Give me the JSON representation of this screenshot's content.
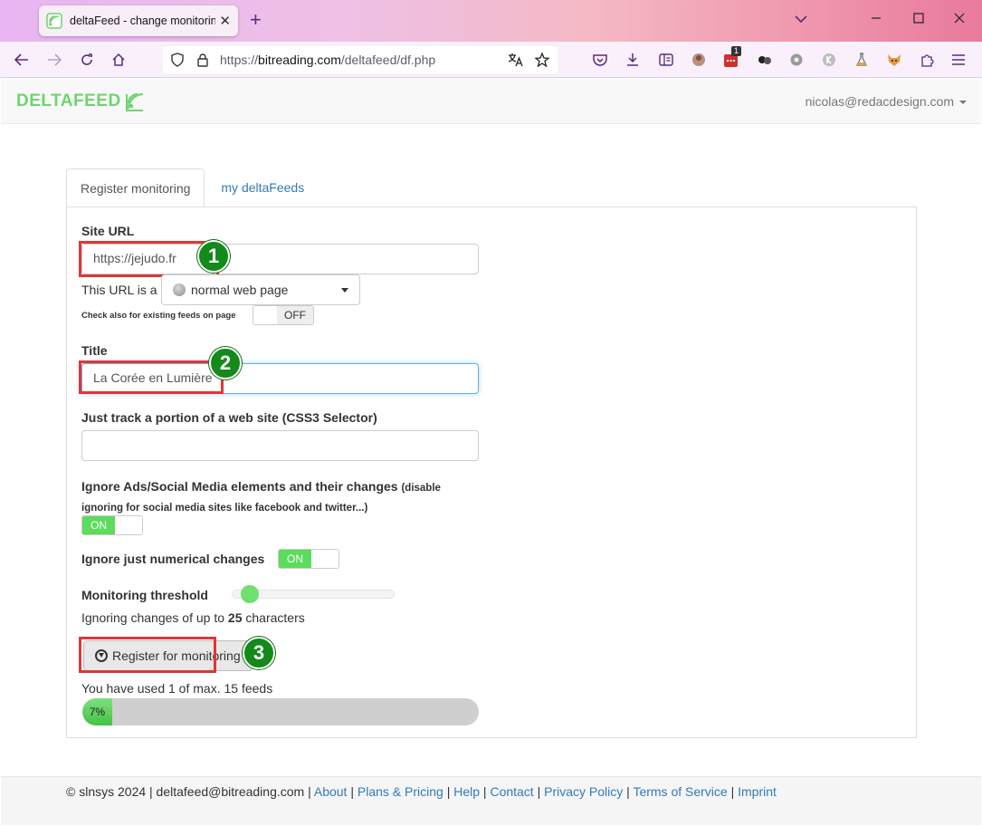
{
  "browser": {
    "tab_title": "deltaFeed - change monitoring",
    "url_prefix": "https://",
    "url_domain": "bitreading.com",
    "url_path": "/deltafeed/df.php",
    "ext_badge_count": "1"
  },
  "app": {
    "logo_text_1": "DELTA",
    "logo_text_2": "FEED",
    "user_email": "nicolas@redacdesign.com"
  },
  "tabs": [
    {
      "label": "Register monitoring"
    },
    {
      "label": "my deltaFeeds"
    }
  ],
  "form": {
    "site_url_label": "Site URL",
    "site_url_value": "https://jejudo.fr",
    "url_type_prefix": "This URL is a",
    "url_type_value": "normal web page",
    "check_feeds_label": "Check also for existing feeds on page",
    "check_feeds_toggle": "OFF",
    "title_label": "Title",
    "title_value": "La Corée en Lumière",
    "selector_label": "Just track a portion of a web site (CSS3 Selector)",
    "selector_value": "",
    "ignore_ads_label": "Ignore Ads/Social Media elements and their changes",
    "ignore_ads_note": "(disable ignoring for social media sites like facebook and twitter...)",
    "ignore_ads_toggle": "ON",
    "ignore_numeric_label": "Ignore just numerical changes",
    "ignore_numeric_toggle": "ON",
    "threshold_label": "Monitoring threshold",
    "threshold_text_pre": "Ignoring changes of up to",
    "threshold_value": "25",
    "threshold_text_post": "characters",
    "threshold_fraction": 0.05,
    "register_button": "Register for monitoring",
    "usage_text": "You have used 1 of max. 15 feeds",
    "usage_percent_label": "7%",
    "usage_fraction": 0.07
  },
  "annotations": {
    "step1": "1",
    "step2": "2",
    "step3": "3"
  },
  "footer": {
    "copyright": "© slnsys 2024 | deltafeed@bitreading.com |",
    "links": [
      "About",
      "Plans & Pricing",
      "Help",
      "Contact",
      "Privacy Policy",
      "Terms of Service",
      "Imprint"
    ],
    "separator": "|"
  },
  "colors": {
    "accent_green": "#6fd46f",
    "link_blue": "#337ab7",
    "annotation_red": "#e03636",
    "badge_green": "#138a1a"
  }
}
